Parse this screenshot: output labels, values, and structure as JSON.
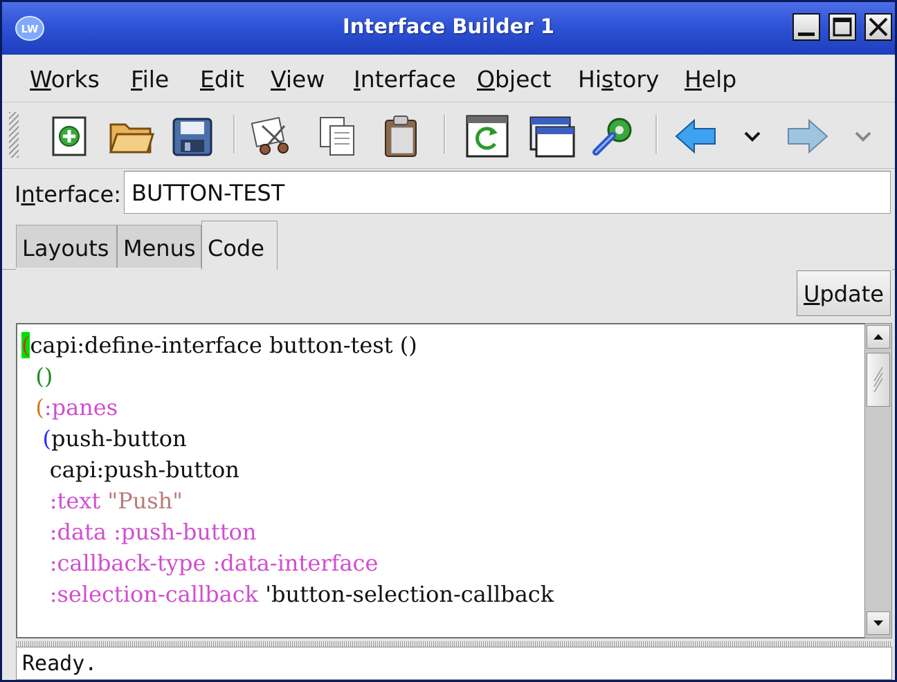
{
  "window": {
    "title": "Interface Builder 1",
    "logo_text": "LW"
  },
  "menu": [
    {
      "label": "Works",
      "underline": 0
    },
    {
      "label": "File",
      "underline": 0
    },
    {
      "label": "Edit",
      "underline": 0
    },
    {
      "label": "View",
      "underline": 0
    },
    {
      "label": "Interface",
      "underline": 0
    },
    {
      "label": "Object",
      "underline": 0
    },
    {
      "label": "History",
      "underline": 2
    },
    {
      "label": "Help",
      "underline": 0
    }
  ],
  "toolbar": {
    "icons": [
      "new-icon",
      "open-folder-icon",
      "save-disk-icon",
      "cut-icon",
      "copy-icon",
      "paste-icon",
      "refresh-icon",
      "window-icon",
      "tools-gear-icon",
      "back-arrow-icon",
      "back-history-dropdown-icon",
      "forward-arrow-icon",
      "forward-history-dropdown-icon"
    ]
  },
  "interface_field": {
    "label": "Interface:",
    "value": "BUTTON-TEST"
  },
  "tabs": [
    {
      "label": "Layouts",
      "active": false
    },
    {
      "label": "Menus",
      "active": false
    },
    {
      "label": "Code",
      "active": true
    }
  ],
  "update_button": "Update",
  "code_lines": [
    [
      {
        "t": "(",
        "c": "#c0392b",
        "bg": "#00e000"
      },
      {
        "t": "capi:define-interface button-test ()",
        "c": "#111111"
      }
    ],
    [
      {
        "t": "  ()",
        "c": "#1f8a1f"
      }
    ],
    [
      {
        "t": "  (",
        "c": "#d07a1a"
      },
      {
        "t": ":panes",
        "c": "#d04ed0"
      }
    ],
    [
      {
        "t": "   (",
        "c": "#2a2aff"
      },
      {
        "t": "push-button",
        "c": "#111111"
      }
    ],
    [
      {
        "t": "    capi:push-button",
        "c": "#111111"
      }
    ],
    [
      {
        "t": "    :text ",
        "c": "#d04ed0"
      },
      {
        "t": "\"Push\"",
        "c": "#b87a7a"
      }
    ],
    [
      {
        "t": "    :data :push-button",
        "c": "#d04ed0"
      }
    ],
    [
      {
        "t": "    :callback-type :data-interface",
        "c": "#d04ed0"
      }
    ],
    [
      {
        "t": "    :selection-callback ",
        "c": "#d04ed0"
      },
      {
        "t": "'button-selection-callback",
        "c": "#111111"
      }
    ]
  ],
  "status": "Ready.",
  "colors": {
    "titlebar": "#2f53d6",
    "keyword": "#d04ed0",
    "string": "#b87a7a",
    "cursor_bg": "#00e000"
  }
}
